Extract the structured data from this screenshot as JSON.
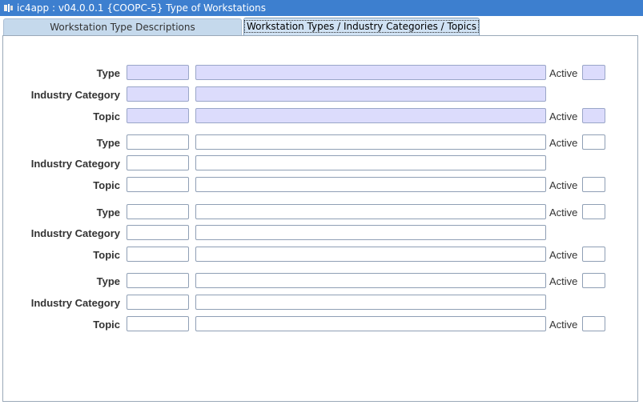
{
  "window": {
    "title": "ic4app : v04.0.0.1  {COOPC-5} Type of Workstations",
    "icon": "app-icon"
  },
  "tabs": [
    {
      "label": "Workstation Type Descriptions",
      "active": false
    },
    {
      "label": "Workstation Types / Industry Categories / Topics",
      "active": true
    }
  ],
  "labels": {
    "type": "Type",
    "industry_category": "Industry Category",
    "topic": "Topic",
    "active": "Active"
  },
  "records": [
    {
      "type_code": "",
      "type_description": "",
      "type_active": "",
      "industry_category_code": "",
      "industry_category_description": "",
      "topic_code": "",
      "topic_description": "",
      "topic_active": "",
      "selected": true
    },
    {
      "type_code": "",
      "type_description": "",
      "type_active": "",
      "industry_category_code": "",
      "industry_category_description": "",
      "topic_code": "",
      "topic_description": "",
      "topic_active": "",
      "selected": false
    },
    {
      "type_code": "",
      "type_description": "",
      "type_active": "",
      "industry_category_code": "",
      "industry_category_description": "",
      "topic_code": "",
      "topic_description": "",
      "topic_active": "",
      "selected": false
    },
    {
      "type_code": "",
      "type_description": "",
      "type_active": "",
      "industry_category_code": "",
      "industry_category_description": "",
      "topic_code": "",
      "topic_description": "",
      "topic_active": "",
      "selected": false
    }
  ],
  "colors": {
    "titlebar": "#3d7fcf",
    "tab": "#c5d9ec",
    "selected_field": "#dcdcfc"
  }
}
